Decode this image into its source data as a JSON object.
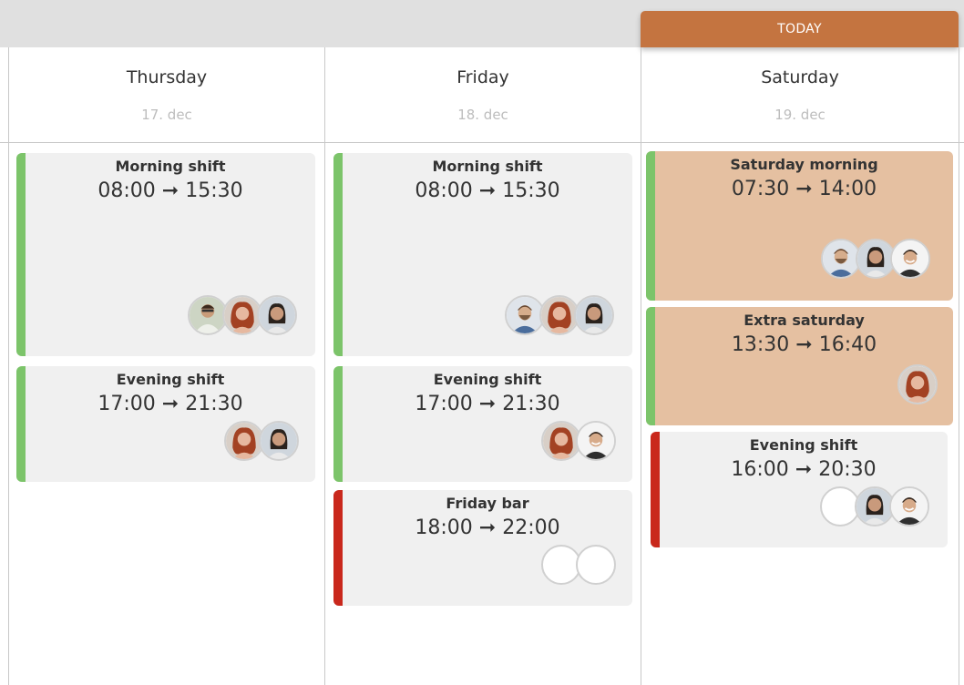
{
  "today_label": "TODAY",
  "days": [
    {
      "name": "Thursday",
      "date": "17. dec"
    },
    {
      "name": "Friday",
      "date": "18. dec"
    },
    {
      "name": "Saturday",
      "date": "19. dec"
    }
  ],
  "shifts": [
    {
      "title": "Morning shift",
      "time": "08:00 ➞ 15:30"
    },
    {
      "title": "Evening shift",
      "time": "17:00 ➞ 21:30"
    },
    {
      "title": "Morning shift",
      "time": "08:00 ➞ 15:30"
    },
    {
      "title": "Evening shift",
      "time": "17:00 ➞ 21:30"
    },
    {
      "title": "Friday bar",
      "time": "18:00 ➞ 22:00"
    },
    {
      "title": "Saturday morning",
      "time": "07:30 ➞ 14:00"
    },
    {
      "title": "Extra saturday",
      "time": "13:30 ➞ 16:40"
    },
    {
      "title": "Evening shift",
      "time": "16:00 ➞ 20:30"
    }
  ],
  "colors": {
    "accent": "#c47440",
    "highlight_card": "#e5c0a1",
    "status_green": "#7cc46a",
    "status_red": "#c9281c",
    "card": "#f0f0f0"
  },
  "avatar_icons": [
    "person-photo-avatar",
    "empty-slot-avatar"
  ]
}
